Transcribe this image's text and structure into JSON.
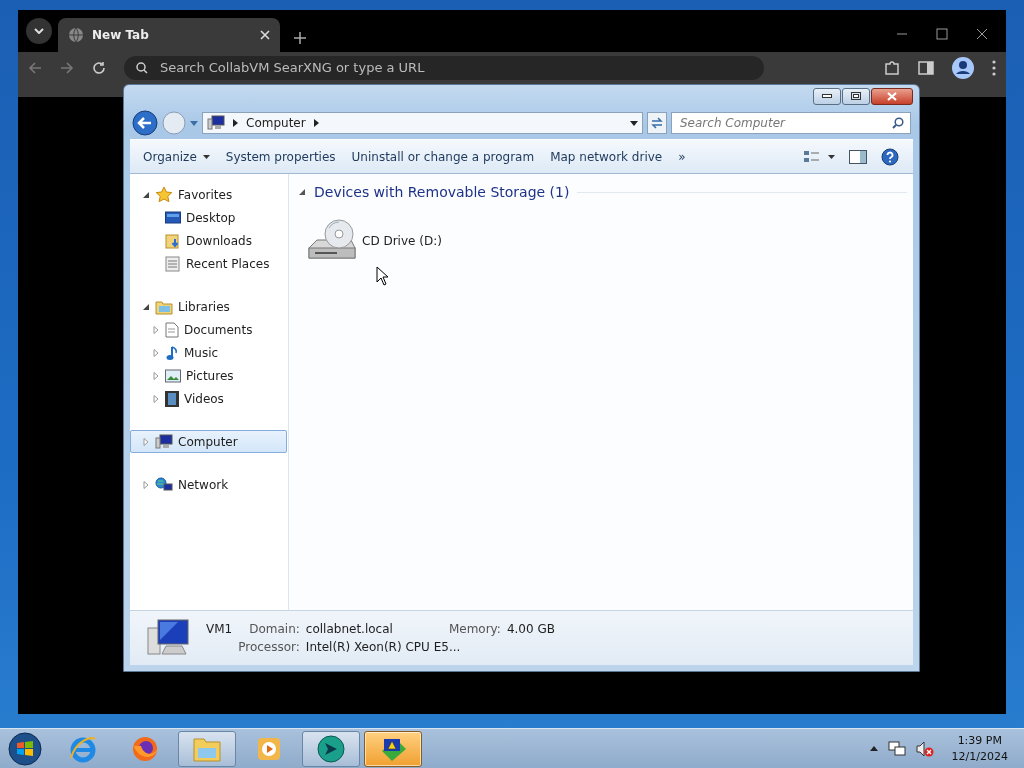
{
  "browser": {
    "tabs": [
      {
        "title": "New Tab",
        "selected": true
      }
    ],
    "address": {
      "placeholder": "Search CollabVM SearXNG or type a URL"
    }
  },
  "explorer": {
    "address_path": [
      "Computer"
    ],
    "search": {
      "placeholder": "Search Computer"
    },
    "toolbar": [
      {
        "label": "Organize",
        "kind": "menu"
      },
      {
        "label": "System properties",
        "kind": "plain"
      },
      {
        "label": "Uninstall or change a program",
        "kind": "plain"
      },
      {
        "label": "Map network drive",
        "kind": "plain"
      },
      {
        "label": "»",
        "kind": "overflow"
      }
    ],
    "nav": [
      {
        "label": "Favorites",
        "kind": "star",
        "expanded": true,
        "selected": false,
        "children": [
          {
            "label": "Desktop",
            "kind": "desktop",
            "selected": false
          },
          {
            "label": "Downloads",
            "kind": "downloads",
            "selected": false
          },
          {
            "label": "Recent Places",
            "kind": "recent",
            "selected": false
          }
        ]
      },
      {
        "label": "Libraries",
        "kind": "library",
        "expanded": true,
        "selected": false,
        "children": [
          {
            "label": "Documents",
            "kind": "document",
            "expanded": false,
            "selected": false
          },
          {
            "label": "Music",
            "kind": "music",
            "expanded": false,
            "selected": false
          },
          {
            "label": "Pictures",
            "kind": "pictures",
            "expanded": false,
            "selected": false
          },
          {
            "label": "Videos",
            "kind": "videos",
            "expanded": false,
            "selected": false
          }
        ]
      },
      {
        "label": "Computer",
        "kind": "computer",
        "expanded": false,
        "selected": true
      },
      {
        "label": "Network",
        "kind": "network",
        "expanded": false,
        "selected": false
      }
    ],
    "groups": [
      {
        "title": "Devices with Removable Storage (1)",
        "expanded": true,
        "items": [
          {
            "label": "CD Drive (D:)",
            "kind": "cd-drive"
          }
        ]
      }
    ],
    "details": {
      "name": "VM1",
      "fields": [
        {
          "label": "Domain:",
          "value": "collabnet.local"
        },
        {
          "label": "Memory:",
          "value": "4.00 GB"
        },
        {
          "label": "Processor:",
          "value": "Intel(R) Xeon(R) CPU E5..."
        }
      ]
    }
  },
  "taskbar": {
    "apps": [
      {
        "kind": "ie",
        "open": false,
        "selected": false
      },
      {
        "kind": "firefox",
        "open": false,
        "selected": false
      },
      {
        "kind": "explorer",
        "open": true,
        "selected": false
      },
      {
        "kind": "media",
        "open": false,
        "selected": false
      },
      {
        "kind": "globe",
        "open": true,
        "selected": false
      },
      {
        "kind": "vm",
        "open": true,
        "selected": true
      }
    ],
    "time": "1:39 PM",
    "date": "12/1/2024"
  }
}
